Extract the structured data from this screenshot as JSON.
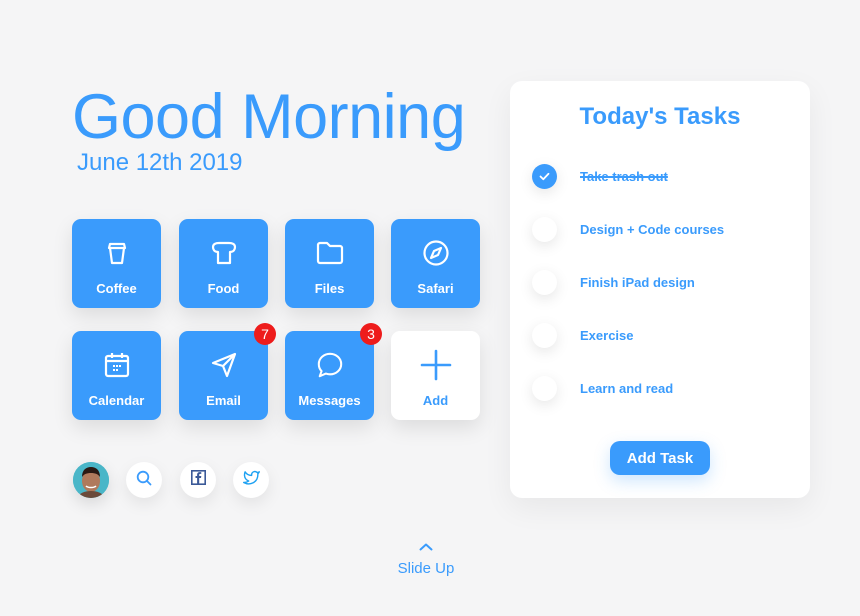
{
  "header": {
    "greeting": "Good Morning",
    "date": "June 12th 2019"
  },
  "apps": [
    {
      "label": "Coffee",
      "icon": "coffee-cup-icon"
    },
    {
      "label": "Food",
      "icon": "bread-icon"
    },
    {
      "label": "Files",
      "icon": "folder-icon"
    },
    {
      "label": "Safari",
      "icon": "compass-icon"
    },
    {
      "label": "Calendar",
      "icon": "calendar-icon"
    },
    {
      "label": "Email",
      "icon": "send-icon",
      "badge": "7"
    },
    {
      "label": "Messages",
      "icon": "chat-bubble-icon",
      "badge": "3"
    },
    {
      "label": "Add",
      "icon": "plus-icon"
    }
  ],
  "social": {
    "avatar": "user-avatar",
    "buttons": [
      "search-icon",
      "facebook-icon",
      "twitter-icon"
    ]
  },
  "tasks_panel": {
    "title": "Today's Tasks",
    "tasks": [
      {
        "label": "Take trash out",
        "done": true
      },
      {
        "label": "Design + Code courses",
        "done": false
      },
      {
        "label": "Finish iPad design",
        "done": false
      },
      {
        "label": "Exercise",
        "done": false
      },
      {
        "label": "Learn and read",
        "done": false
      }
    ],
    "add_button": "Add Task"
  },
  "footer": {
    "slide_up": "Slide Up"
  },
  "colors": {
    "accent": "#3a9bfc",
    "badge": "#ee1c1c",
    "background": "#f5f5f6"
  }
}
